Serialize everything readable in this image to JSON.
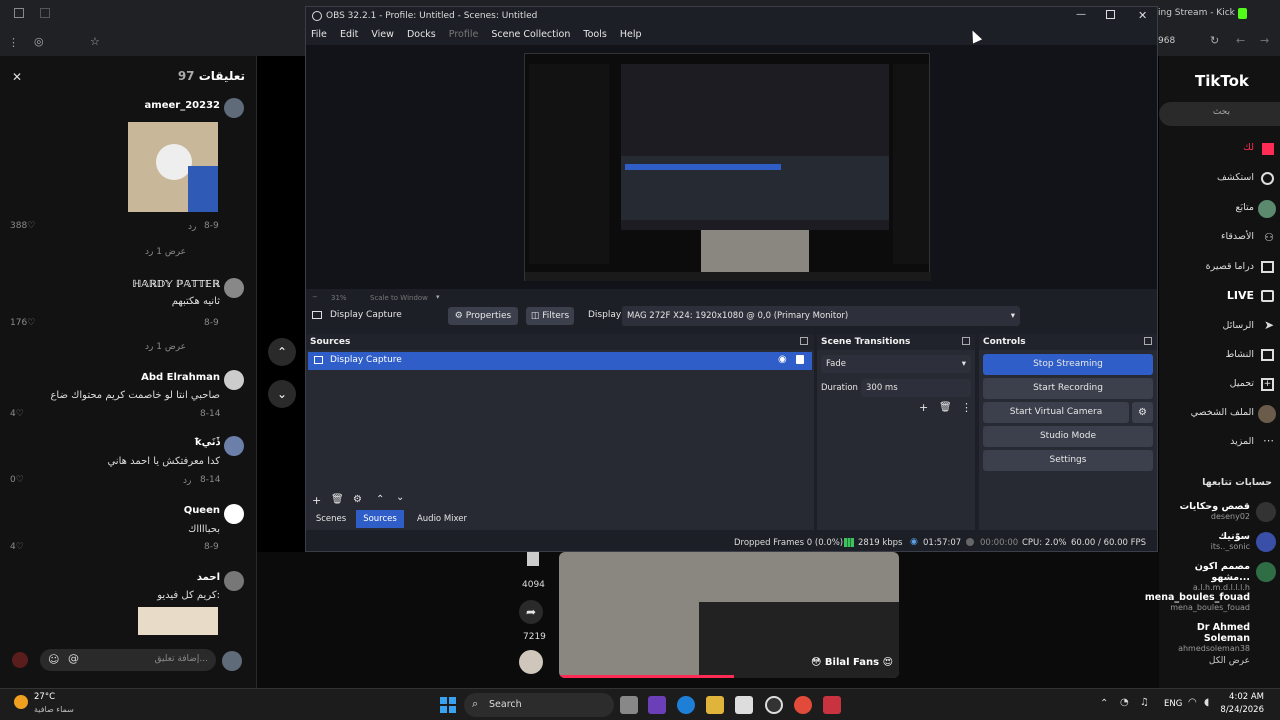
{
  "browser": {
    "tab_title": "ing Stream - Kick D",
    "count": "968"
  },
  "comments": {
    "header_label": "تعليقات",
    "header_count": "97",
    "items": [
      {
        "name": "ameer_20232",
        "date": "8-9",
        "reply": "رد",
        "likes": "388",
        "view": "عرض 1 رد"
      },
      {
        "name": "ℍ𝔸ℝ𝔻𝕐 ℙ𝔸𝕋𝕋𝔼ℝ",
        "text": "ثانيه هكتبهم",
        "date": "8-9",
        "likes": "176",
        "reply": "رد",
        "view": "عرض 1 رد"
      },
      {
        "name": "Abd Elrahman",
        "text": "صاحبي انتا لو خاصمت كريم محتواك ضاع",
        "date": "8-14",
        "likes": "4"
      },
      {
        "name": "ꝁڏَنَي",
        "text": "كدا معرفتكش يا احمد هاني",
        "date": "8-14",
        "likes": "0",
        "reply": "رد"
      },
      {
        "name": "Queen",
        "text": "بحبااااك",
        "date": "8-9",
        "likes": "4"
      },
      {
        "name": "احمد",
        "text": "كريم كل فيديو:"
      }
    ],
    "input_placeholder": "إضافة تعليق..."
  },
  "tiktok": {
    "logo": "TikTok",
    "search_placeholder": "بحث",
    "nav": [
      {
        "label": "لك",
        "icon": "home-icon"
      },
      {
        "label": "استكشف",
        "icon": "compass-icon"
      },
      {
        "label": "متابَع",
        "icon": "following-icon"
      },
      {
        "label": "الأصدقاء",
        "icon": "friends-icon"
      },
      {
        "label": "دراما قصيرة",
        "icon": "drama-icon"
      },
      {
        "label": "LIVE",
        "icon": "live-icon"
      },
      {
        "label": "الرسائل",
        "icon": "send-icon"
      },
      {
        "label": "النشاط",
        "icon": "inbox-icon"
      },
      {
        "label": "تحميل",
        "icon": "upload-icon"
      },
      {
        "label": "الملف الشخصي",
        "icon": "profile-icon"
      },
      {
        "label": "المزيد",
        "icon": "more-icon"
      }
    ],
    "following_title": "حسابات تتابعها",
    "following": [
      {
        "name": "قصص وحكايات",
        "handle": "deseny02"
      },
      {
        "name": "سوّنيك",
        "handle": "its.._sonic"
      },
      {
        "name": "مصمم اكون مشهو...",
        "handle": "a.l.h.m.d.l.l.l.h"
      },
      {
        "name": "mena_boules_fouad",
        "handle": "mena_boules_fouad"
      },
      {
        "name": "Dr Ahmed Soleman",
        "handle": "ahmedsoleman38"
      }
    ],
    "see_all": "عرض الكل"
  },
  "video": {
    "bookmark_count": "4094",
    "share_count": "7219",
    "caption": "😳 Bilal Fans 😍"
  },
  "obs": {
    "title": "OBS 32.2.1 - Profile: Untitled - Scenes: Untitled",
    "menu": [
      "File",
      "Edit",
      "View",
      "Docks",
      "Profile",
      "Scene Collection",
      "Tools",
      "Help"
    ],
    "preview_zoom": "31%",
    "preview_mode": "Scale to Window",
    "source_name": "Display Capture",
    "properties_label": "Properties",
    "filters_label": "Filters",
    "display_label": "Display",
    "display_value": "MAG 272F X24: 1920x1080 @ 0,0 (Primary Monitor)",
    "sources_title": "Sources",
    "sources": [
      "Display Capture"
    ],
    "tabs": [
      "Scenes",
      "Sources",
      "Audio Mixer"
    ],
    "transitions_title": "Scene Transitions",
    "transition_value": "Fade",
    "duration_label": "Duration",
    "duration_value": "300 ms",
    "controls_title": "Controls",
    "controls": [
      "Stop Streaming",
      "Start Recording",
      "Start Virtual Camera",
      "Studio Mode",
      "Settings"
    ],
    "status": {
      "dropped": "Dropped Frames 0 (0.0%)",
      "kbps": "2819 kbps",
      "stream_time": "01:57:07",
      "rec_time": "00:00:00",
      "cpu": "CPU: 2.0%",
      "fps": "60.00 / 60.00 FPS"
    },
    "colors": {
      "accent": "#2f5ec8",
      "bg": "#1d1f26"
    }
  },
  "taskbar": {
    "weather_temp": "27°C",
    "weather_desc": "سماء صافية",
    "search": "Search",
    "lang": "ENG",
    "time": "4:02 AM",
    "date": "8/24/2026"
  }
}
